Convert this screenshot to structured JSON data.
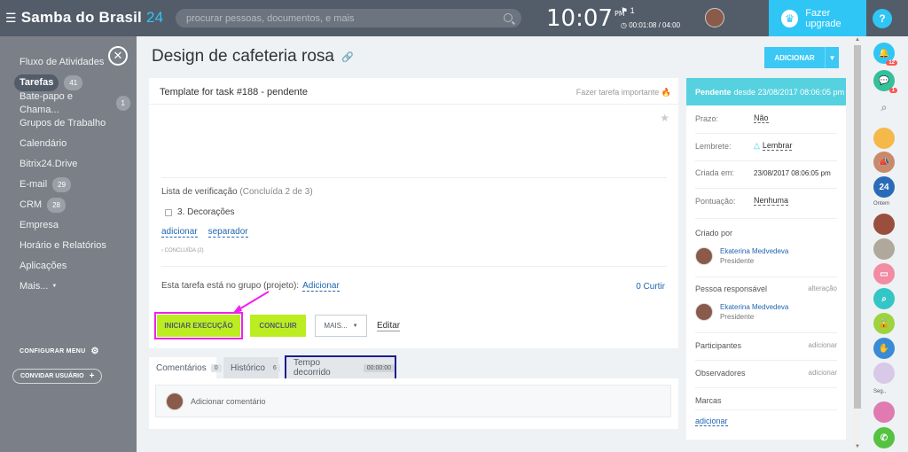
{
  "topbar": {
    "brand": "Samba do Brasil",
    "brand_suffix": "24",
    "search_placeholder": "procurar pessoas, documentos, e mais",
    "time": "10:07",
    "ampm": "PM",
    "flag_count": "1",
    "timer": "00:01:08 / 04:00",
    "upgrade": "Fazer upgrade",
    "help": "?"
  },
  "sidebar": {
    "items": [
      {
        "label": "Fluxo de Atividades",
        "count": ""
      },
      {
        "label": "Tarefas",
        "count": "41"
      },
      {
        "label": "Bate-papo e Chama...",
        "count": "1"
      },
      {
        "label": "Grupos de Trabalho",
        "count": ""
      },
      {
        "label": "Calendário",
        "count": ""
      },
      {
        "label": "Bitrix24.Drive",
        "count": ""
      },
      {
        "label": "E-mail",
        "count": "29"
      },
      {
        "label": "CRM",
        "count": "28"
      },
      {
        "label": "Empresa",
        "count": ""
      },
      {
        "label": "Horário e Relatórios",
        "count": ""
      },
      {
        "label": "Aplicações",
        "count": ""
      },
      {
        "label": "Mais...",
        "count": ""
      }
    ],
    "config_menu": "CONFIGURAR MENU",
    "invite": "CONVIDAR USUÁRIO"
  },
  "page": {
    "title": "Design de cafeteria rosa",
    "add_button": "ADICIONAR"
  },
  "task": {
    "template_title": "Template for task #188 - pendente",
    "important": "Fazer tarefa importante",
    "checklist_label": "Lista de verificação",
    "checklist_progress": "(Concluída 2 de 3)",
    "checklist_item": "3. Decorações",
    "link_add": "adicionar",
    "link_separator": "separador",
    "completed": "› CONCLUÍDA (2)",
    "group_text": "Esta tarefa está no grupo (projeto):",
    "group_link": "Adicionar",
    "likes": "0 Curtir"
  },
  "actions": {
    "start": "INICIAR EXECUÇÃO",
    "complete": "CONCLUIR",
    "more": "MAIS...",
    "edit": "Editar"
  },
  "tabs": [
    {
      "label": "Comentários",
      "count": "0"
    },
    {
      "label": "Histórico",
      "count": "6"
    },
    {
      "label": "Tempo decorrido",
      "count": "00:00:00"
    }
  ],
  "comment_placeholder": "Adicionar comentário",
  "details": {
    "status_bold": "Pendente",
    "status_rest": "desde 23/08/2017 08:06:05 pm",
    "prazo_label": "Prazo:",
    "prazo_value": "Não",
    "lembrete_label": "Lembrete:",
    "lembrete_value": "Lembrar",
    "criada_label": "Criada em:",
    "criada_value": "23/08/2017 08:06:05 pm",
    "pontuacao_label": "Pontuação:",
    "pontuacao_value": "Nenhuma",
    "criado_por": "Criado por",
    "creator_name": "Ekaterina Medvedeva",
    "creator_role": "Presidente",
    "responsavel": "Pessoa responsável",
    "alteracao": "alteração",
    "resp_name": "Ekaterina Medvedeva",
    "resp_role": "Presidente",
    "participantes": "Participantes",
    "observadores": "Observadores",
    "adicionar": "adicionar",
    "marcas": "Marcas",
    "marcas_link": "adicionar"
  },
  "right_panel": {
    "notif_badge": "12",
    "chat_badge": "1",
    "ontem": "Ontem",
    "seg": "Seg.,"
  },
  "colors": {
    "accent": "#2fc6f6",
    "green_button": "#bbed21",
    "highlight_magenta": "#f020f0",
    "highlight_navy": "#1b1d8f"
  }
}
